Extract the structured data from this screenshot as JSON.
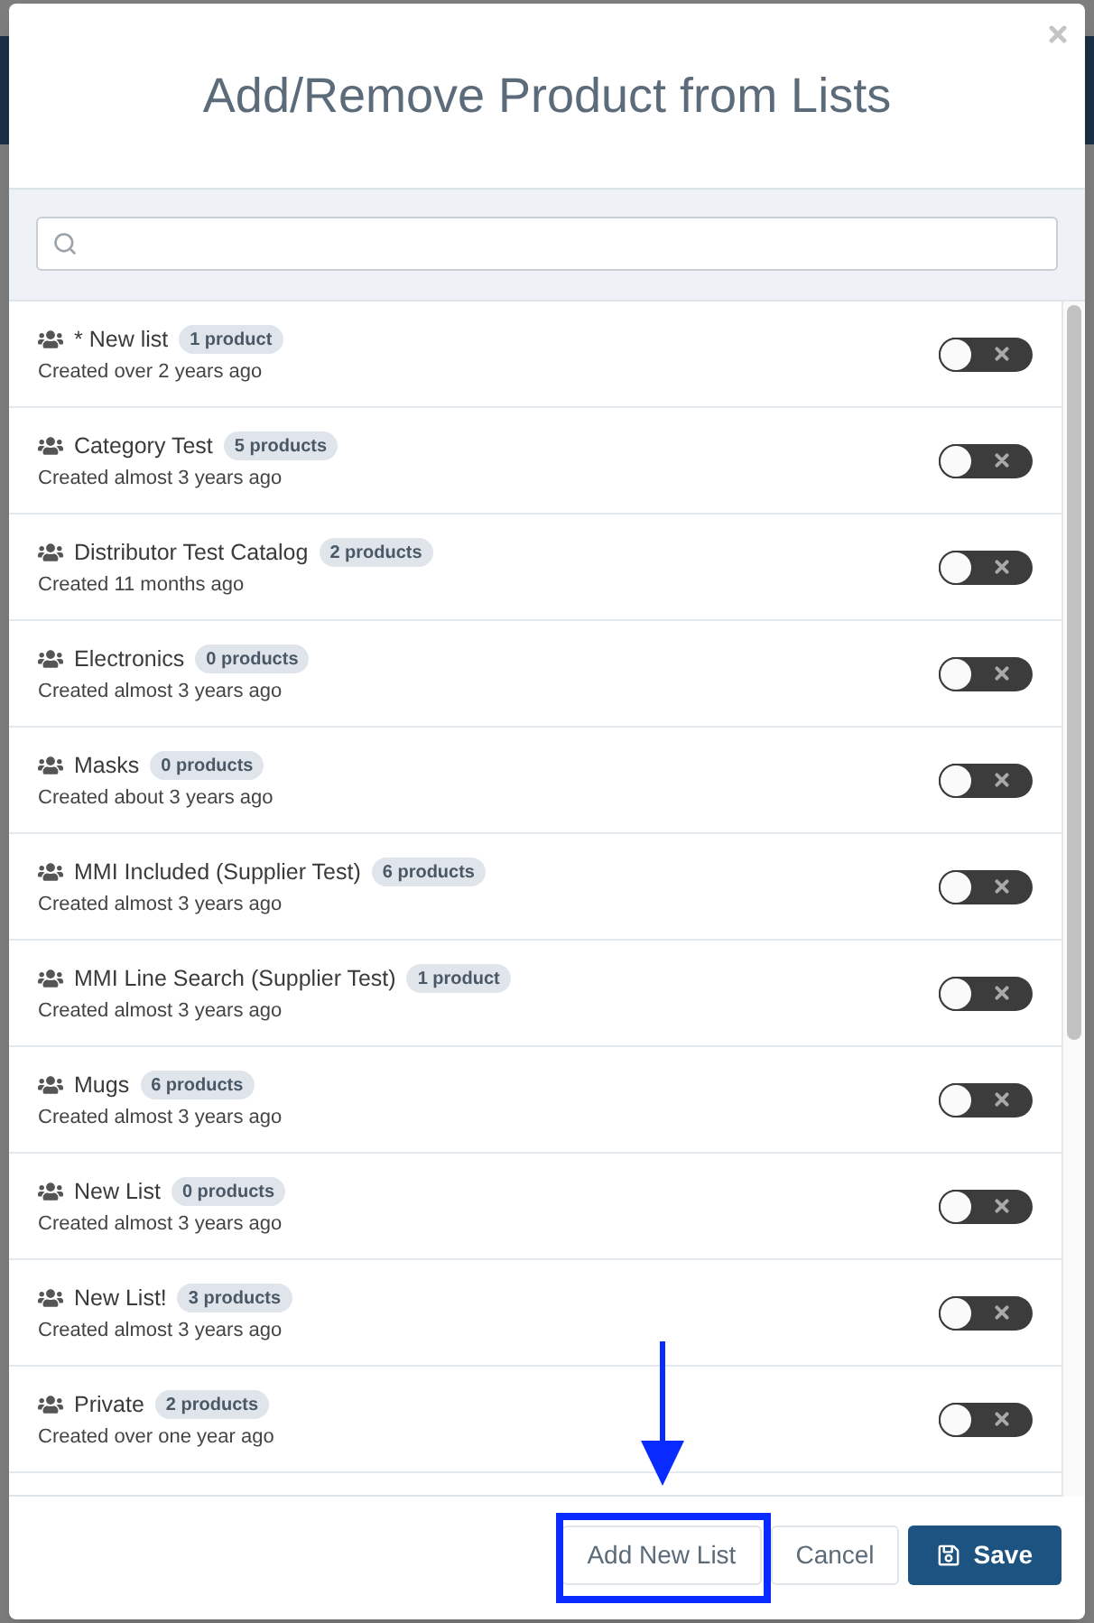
{
  "dialog": {
    "title": "Add/Remove Product from Lists"
  },
  "lists": [
    {
      "name": "* New list",
      "badge": "1 product",
      "created": "Created over 2 years ago",
      "on": false
    },
    {
      "name": "Category Test",
      "badge": "5 products",
      "created": "Created almost 3 years ago",
      "on": false
    },
    {
      "name": "Distributor Test Catalog",
      "badge": "2 products",
      "created": "Created 11 months ago",
      "on": false
    },
    {
      "name": "Electronics",
      "badge": "0 products",
      "created": "Created almost 3 years ago",
      "on": false
    },
    {
      "name": "Masks",
      "badge": "0 products",
      "created": "Created about 3 years ago",
      "on": false
    },
    {
      "name": "MMI Included (Supplier Test)",
      "badge": "6 products",
      "created": "Created almost 3 years ago",
      "on": false
    },
    {
      "name": "MMI Line Search (Supplier Test)",
      "badge": "1 product",
      "created": "Created almost 3 years ago",
      "on": false
    },
    {
      "name": "Mugs",
      "badge": "6 products",
      "created": "Created almost 3 years ago",
      "on": false
    },
    {
      "name": "New List",
      "badge": "0 products",
      "created": "Created almost 3 years ago",
      "on": false
    },
    {
      "name": "New List!",
      "badge": "3 products",
      "created": "Created almost 3 years ago",
      "on": false
    },
    {
      "name": "Private",
      "badge": "2 products",
      "created": "Created over one year ago",
      "on": false
    }
  ],
  "buttons": [
    {
      "label": "Add New List",
      "kind": "secondary",
      "highlighted": true
    },
    {
      "label": "Cancel",
      "kind": "secondary",
      "highlighted": false
    },
    {
      "label": "Save",
      "kind": "primary",
      "highlighted": false
    }
  ]
}
